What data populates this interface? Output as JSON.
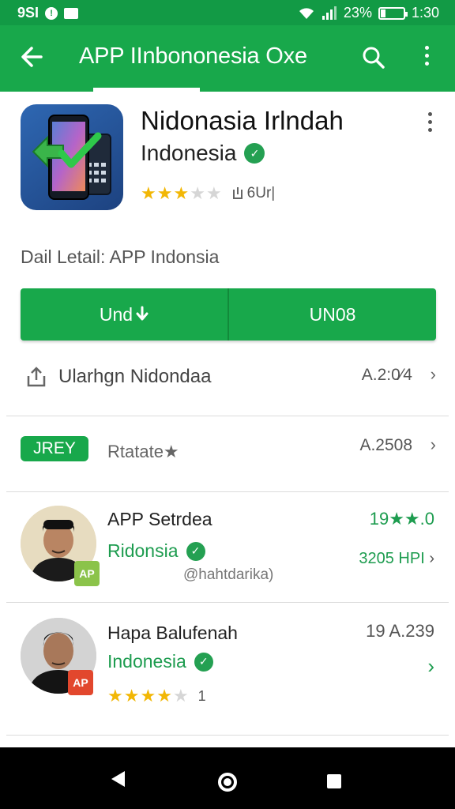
{
  "status_bar": {
    "left_text": "9SI",
    "notification_icon": "alert-icon",
    "image_icon": "gallery-icon",
    "battery_percent": "23%",
    "battery_level": 0.23,
    "time": "1:30"
  },
  "app_bar": {
    "title": "APP IInbononesia  Oxe",
    "back_icon": "back-arrow-icon",
    "search_icon": "search-icon",
    "more_icon": "more-vert-icon"
  },
  "app": {
    "name": "Nidonasia Irlndah",
    "developer": "Indonesia",
    "verified_glyph": "✓",
    "rating_stars": 3,
    "rating_max": 5,
    "download_text": "6Ur|"
  },
  "detail_line": "Dail Letail: APP Indonsia",
  "buttons": {
    "left_label": "Und",
    "right_label": "UN08"
  },
  "share_row": {
    "label": "Ularhgn Nidondaa",
    "size": "A.2:0⁄4"
  },
  "section_row": {
    "badge": "JREY",
    "label": "Rtatate★",
    "size": "A.2508"
  },
  "list": [
    {
      "title": "APP Setrdea",
      "subtitle": "Ridonsia",
      "right_top": "19★★.0",
      "right_bottom": "3205 HPI",
      "handle": "@hahtdarika)",
      "badge_text": "AP",
      "badge_color": "#8bc34a"
    },
    {
      "title": "Hapa Balufenah",
      "subtitle": "Indonesia",
      "right_top": "19 A.239",
      "rating_stars": 4,
      "rating_count": "1",
      "badge_text": "AP",
      "badge_color": "#e2472d"
    }
  ],
  "colors": {
    "primary": "#18a84b",
    "status": "#129a45",
    "accent_text": "#1d9c4f",
    "star": "#f2b705"
  }
}
